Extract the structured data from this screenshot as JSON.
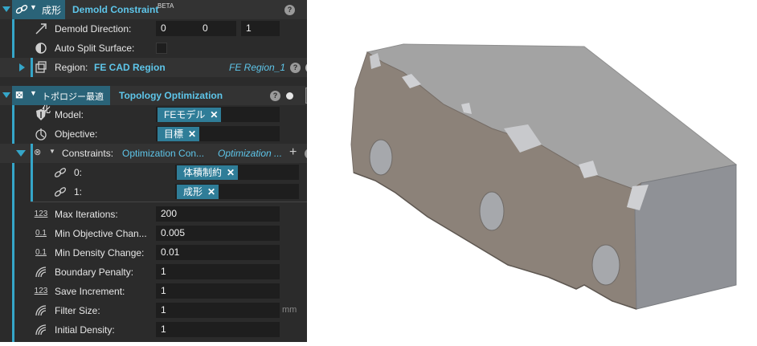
{
  "demold": {
    "tab_label": "成形",
    "title": "Demold Constraint",
    "badge": "BETA",
    "direction_label": "Demold Direction:",
    "direction_values": [
      "0",
      "0",
      "1"
    ],
    "autosplit_label": "Auto Split Surface:",
    "region_label": "Region:",
    "region_value": "FE CAD Region",
    "region_ref": "FE Region_1"
  },
  "topo": {
    "tab_label": "トポロジー最適化",
    "title": "Topology Optimization",
    "model_label": "Model:",
    "model_tag": "FEモデル",
    "objective_label": "Objective:",
    "objective_tag": "目標",
    "constraints_label": "Constraints:",
    "constraints_value": "Optimization Con...",
    "constraints_ref": "Optimization ...",
    "constraints": [
      {
        "index": "0:",
        "tag": "体積制約"
      },
      {
        "index": "1:",
        "tag": "成形"
      }
    ],
    "params": [
      {
        "label": "Max Iterations:",
        "value": "200",
        "icon": "123"
      },
      {
        "label": "Min Objective Chan...",
        "value": "0.005",
        "icon": "0.1"
      },
      {
        "label": "Min Density Change:",
        "value": "0.01",
        "icon": "0.1"
      },
      {
        "label": "Boundary Penalty:",
        "value": "1",
        "icon": "arc"
      },
      {
        "label": "Save Increment:",
        "value": "1",
        "icon": "123"
      },
      {
        "label": "Filter Size:",
        "value": "1",
        "icon": "arc",
        "unit": "mm"
      },
      {
        "label": "Initial Density:",
        "value": "1",
        "icon": "arc"
      }
    ]
  },
  "colors": {
    "panel": "#2b2b2b",
    "accent": "#35a6c9",
    "tag": "#2f7d98",
    "field": "#1e1e1e"
  },
  "icon_names": [
    "link-icon",
    "arrow-diagonal-icon",
    "half-circle-icon",
    "region-icon",
    "shield-icon",
    "objective-icon",
    "arc-icon",
    "help-icon",
    "cursor-icon"
  ]
}
